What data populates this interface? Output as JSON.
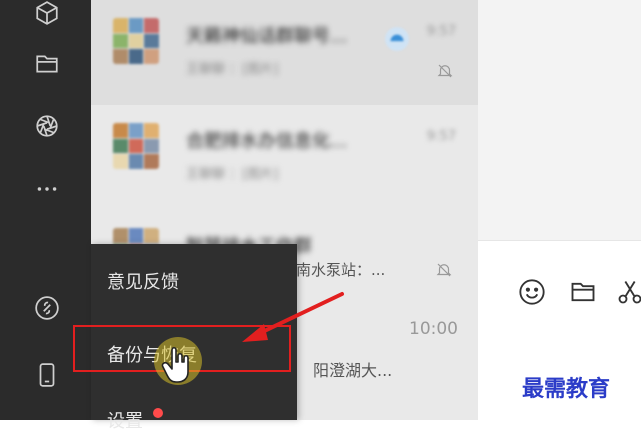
{
  "sidebar": {
    "icons": [
      "cube-icon",
      "folder-icon",
      "aperture-icon",
      "more-icon",
      "link-icon",
      "phone-icon"
    ]
  },
  "chats": [
    {
      "name": "天籁神仙话群聊号...",
      "preview": "王聊聊 ：[图片]",
      "time": "9:57"
    },
    {
      "name": "合肥排水办信息化...",
      "preview": "王聊聊 ：[图片]",
      "time": "9:57"
    },
    {
      "name": "智慧排水工作群",
      "preview": "",
      "time": ""
    }
  ],
  "visible_snippets": {
    "chat3_preview": "南水泵站：...",
    "time_row4": "10:00",
    "chat4_preview": "阳澄湖大..."
  },
  "popup_menu": {
    "items": [
      {
        "label": "意见反馈"
      },
      {
        "label": "备份与恢复"
      },
      {
        "label": "设置"
      }
    ]
  },
  "toolbar": {
    "icons": [
      "emoji-icon",
      "folder-icon",
      "scissors-icon"
    ]
  },
  "colors": {
    "highlight": "#e21f1f",
    "arrow": "#e21f1f",
    "badge": "#ff4b4b"
  },
  "watermark": {
    "text": "最需教育"
  }
}
